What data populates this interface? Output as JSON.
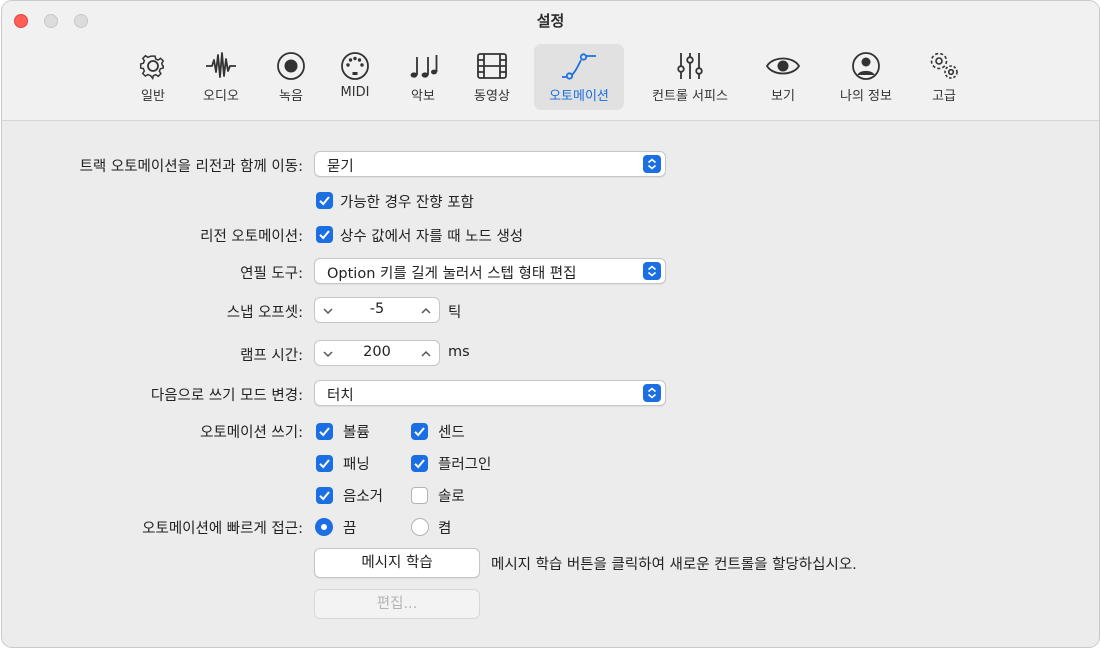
{
  "window": {
    "title": "설정"
  },
  "tabs": [
    {
      "label": "일반",
      "icon": "gear-icon"
    },
    {
      "label": "오디오",
      "icon": "waveform-icon"
    },
    {
      "label": "녹음",
      "icon": "record-icon"
    },
    {
      "label": "MIDI",
      "icon": "midi-port-icon"
    },
    {
      "label": "악보",
      "icon": "music-notes-icon"
    },
    {
      "label": "동영상",
      "icon": "film-icon"
    },
    {
      "label": "오토메이션",
      "icon": "automation-curve-icon",
      "active": true
    },
    {
      "label": "컨트롤 서피스",
      "icon": "sliders-icon"
    },
    {
      "label": "보기",
      "icon": "eye-icon"
    },
    {
      "label": "나의 정보",
      "icon": "person-icon"
    },
    {
      "label": "고급",
      "icon": "gears-icon"
    }
  ],
  "settings": {
    "move_automation": {
      "label": "트랙 오토메이션을 리전과 함께 이동:",
      "value": "묻기"
    },
    "include_tails": {
      "label": "가능한 경우 잔향 포함",
      "checked": true
    },
    "region_automation": {
      "label": "리전 오토메이션:",
      "option": "상수 값에서 자를 때 노드 생성",
      "checked": true
    },
    "pencil_tool": {
      "label": "연필 도구:",
      "value": "Option 키를 길게 눌러서 스텝 형태 편집"
    },
    "snap_offset": {
      "label": "스냅 오프셋:",
      "value": "-5",
      "unit": "틱"
    },
    "ramp_time": {
      "label": "램프 시간:",
      "value": "200",
      "unit": "ms"
    },
    "write_mode": {
      "label": "다음으로 쓰기 모드 변경:",
      "value": "터치"
    },
    "write_automation": {
      "label": "오토메이션 쓰기:",
      "volume": {
        "label": "볼륨",
        "checked": true
      },
      "send": {
        "label": "센드",
        "checked": true
      },
      "pan": {
        "label": "패닝",
        "checked": true
      },
      "plugin": {
        "label": "플러그인",
        "checked": true
      },
      "mute": {
        "label": "음소거",
        "checked": true
      },
      "solo": {
        "label": "솔로",
        "checked": false
      }
    },
    "quick_access": {
      "label": "오토메이션에 빠르게 접근:",
      "off": {
        "label": "끔",
        "selected": true
      },
      "on": {
        "label": "켬",
        "selected": false
      }
    },
    "learn_message": {
      "button": "메시지 학습",
      "hint": "메시지 학습 버튼을 클릭하여 새로운 컨트롤을 할당하십시오."
    },
    "edit": {
      "button": "편집..."
    }
  },
  "colors": {
    "accent": "#1b6fe3",
    "close": "#ff5f57"
  }
}
